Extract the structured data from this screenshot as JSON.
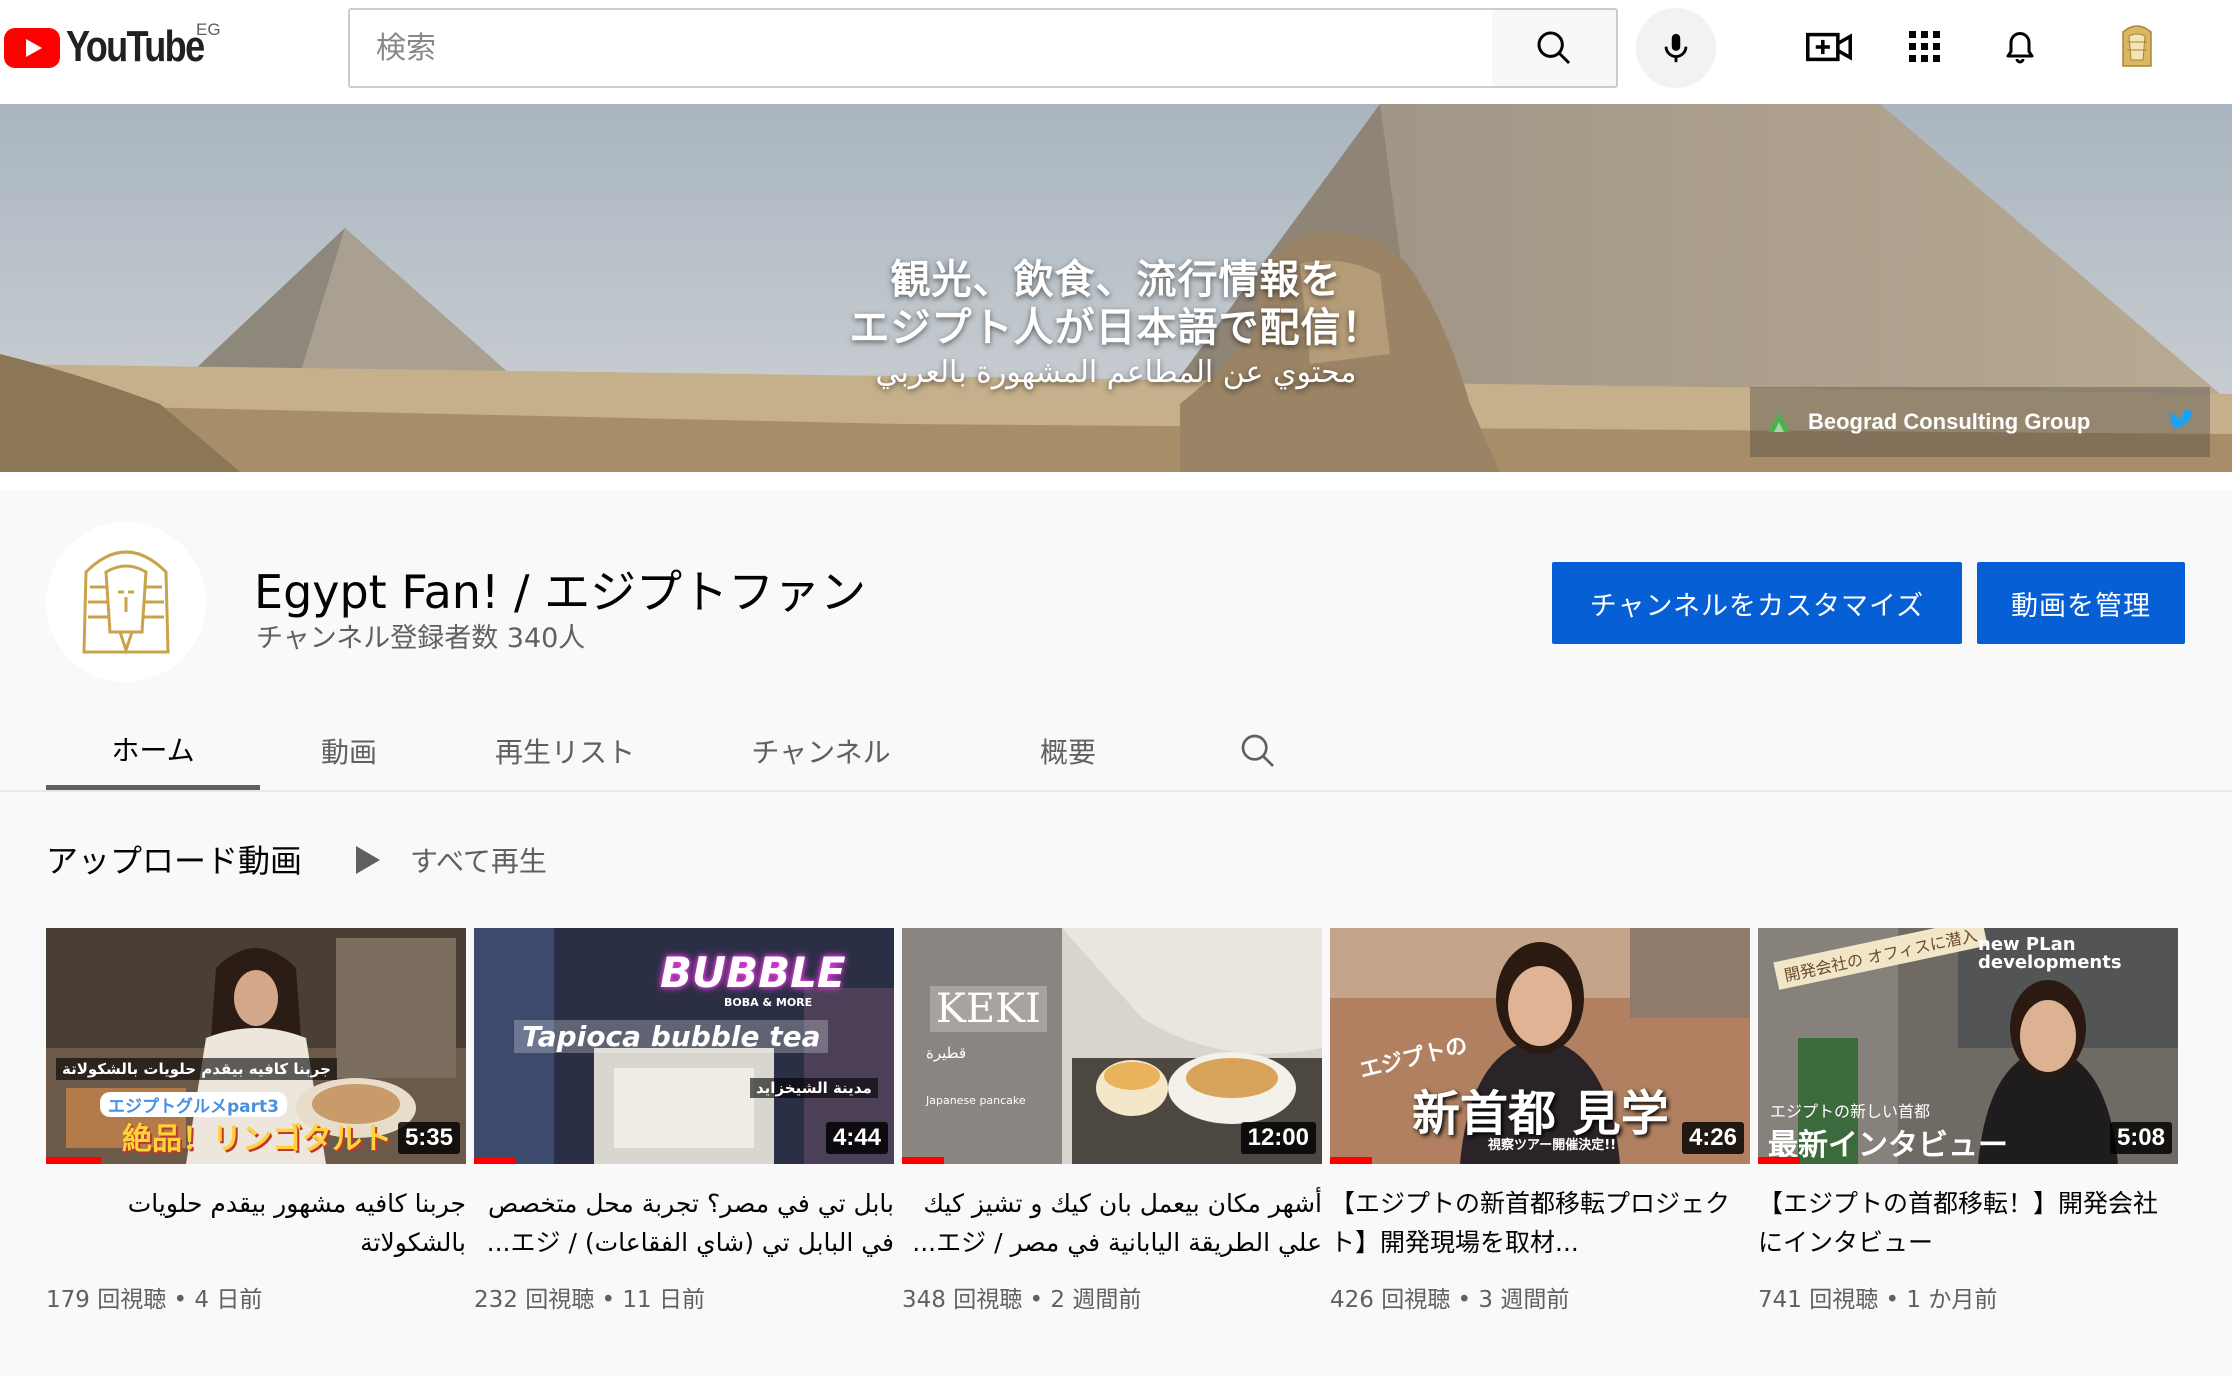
{
  "topbar": {
    "logo_text": "YouTube",
    "country_code": "EG",
    "search_placeholder": "検索",
    "icons": [
      "search-icon",
      "mic-icon",
      "create-video-icon",
      "apps-grid-icon",
      "notifications-bell-icon",
      "account-avatar-icon"
    ]
  },
  "banner": {
    "line1": "観光、飲食、流行情報を",
    "line2": "エジプト人が日本語で配信！",
    "line3": "محتوي عن المطاعم المشهورة بالعربي",
    "link_label": "Beograd Consulting Group"
  },
  "channel": {
    "name": "Egypt Fan! / エジプトファン",
    "subscribers": "チャンネル登録者数 340人",
    "customize_label": "チャンネルをカスタマイズ",
    "manage_label": "動画を管理",
    "tabs": [
      {
        "label": "ホーム",
        "active": true
      },
      {
        "label": "動画",
        "active": false
      },
      {
        "label": "再生リスト",
        "active": false
      },
      {
        "label": "チャンネル",
        "active": false
      },
      {
        "label": "概要",
        "active": false
      }
    ]
  },
  "shelf": {
    "title": "アップロード動画",
    "play_all_label": "すべて再生"
  },
  "videos": [
    {
      "title": "جربنا كافيه مشهور بيقدم حلويات بالشكولاتة",
      "duration": "5:35",
      "views": "179 回視聴",
      "age": "4 日前",
      "thumb_text_1": "جربنا كافيه بيقدم حلويات بالشكولاتة",
      "thumb_text_2": "エジプトグルメpart3",
      "thumb_text_3": "絶品！リンゴタルト",
      "watched": 0.13
    },
    {
      "title": "بابل تي في مصر؟ تجربة محل متخصص في البابل تي (شاي الفقاعات) / エジ...",
      "duration": "4:44",
      "views": "232 回視聴",
      "age": "11 日前",
      "thumb_text_1": "BUBBLE",
      "thumb_text_2": "Tapioca bubble tea",
      "thumb_text_3": "مدينة الشيخزايد",
      "thumb_text_4": "BOBA & MORE",
      "watched": 0.1
    },
    {
      "title": "أشهر مكان بيعمل بان كيك و تشيز كيك علي الطريقة اليابانية في مصر / エジ...",
      "duration": "12:00",
      "views": "348 回視聴",
      "age": "2 週間前",
      "thumb_text_1": "KEKI",
      "thumb_text_2": "قطيرة",
      "thumb_text_3": "Japanese pancake",
      "watched": 0.1
    },
    {
      "title": "【エジプトの新首都移転プロジェクト】開発現場を取材...",
      "duration": "4:26",
      "views": "426 回視聴",
      "age": "3 週間前",
      "thumb_text_1": "エジプトの",
      "thumb_text_2": "新首都 見学",
      "thumb_text_3": "視察ツアー開催決定!!",
      "watched": 0.1
    },
    {
      "title": "【エジプトの首都移転！】開発会社にインタビュー",
      "duration": "5:08",
      "views": "741 回視聴",
      "age": "1 か月前",
      "thumb_text_1": "開発会社の オフィスに潜入",
      "thumb_text_2": "new PLan developments",
      "thumb_text_3": "エジプトの新しい首都",
      "thumb_text_4": "最新インタビュー",
      "watched": 0.1
    }
  ],
  "colors": {
    "brand_red": "#ff0000",
    "button_blue": "#065fd4",
    "secondary_text": "#606060",
    "page_bg": "#f9f9f9"
  }
}
